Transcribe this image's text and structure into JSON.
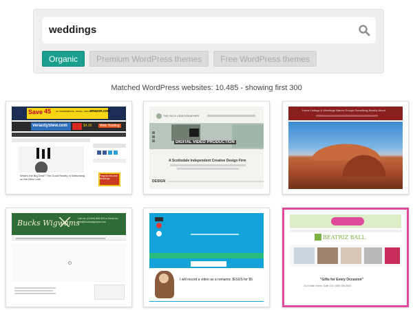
{
  "search": {
    "query": "weddings"
  },
  "tabs": [
    {
      "label": "Organic",
      "active": true
    },
    {
      "label": "Premium WordPress themes",
      "active": false
    },
    {
      "label": "Free WordPress themes",
      "active": false
    }
  ],
  "results_info": "Matched WordPress websites: 10.485 - showing first 300",
  "thumbnails": [
    {
      "ad1": "Save",
      "ad1_pct": "45",
      "ad1_sub": "on Installations, news, menus, and editors pick",
      "ad1_brand": "amazon.com",
      "ad2": "VeracityStew.com",
      "ad2_sub": "Web Hosting",
      "ad2_price": "$4.95",
      "ad3": "Pregnancies and Weddings",
      "caption": "What's the Big Deal? The Good Reality of Debunking on the New Look"
    },
    {
      "site": "THE RICH VIDEOGRAPHER",
      "heading": "DIGITAL VIDEO PRODUCTION",
      "tagline": "A Scottsdale Independent Creative Design Firm",
      "section": "DESIGN"
    },
    {
      "nav": "Home  Listings & Weddings  Nature Groups  Something Nearby  About"
    },
    {
      "title": "Bucks Wigwams",
      "header_contact": "Call Us: (01494) 868 423 or Email Us: info@bluckswigwams.com"
    },
    {
      "promo": "I will record a video as a romantic JESUS for $5"
    },
    {
      "brand": "BEATRIZ BALL",
      "caption": "\"Gifts for Every Occasion\"",
      "footer": "2024 Main Street, Suite 100, (555) 555-5555"
    }
  ],
  "colors": {
    "accent": "#1a9f8e",
    "panel_bg": "#efefef",
    "tab_inactive": "#dcdcdc"
  }
}
